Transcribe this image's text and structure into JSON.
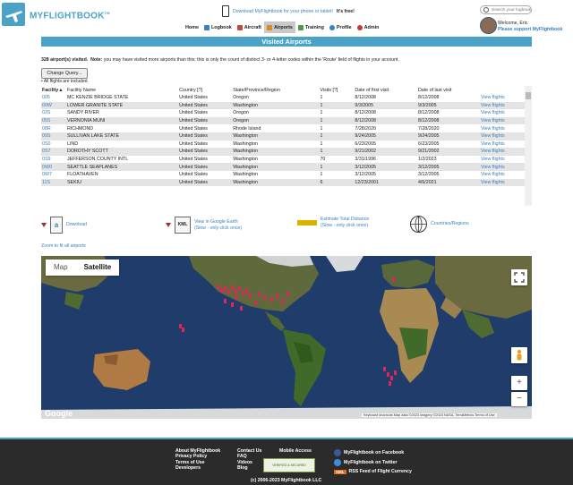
{
  "header": {
    "brand": "MYFLIGHTBOOK",
    "brand_tm": "TM",
    "promo_prefix": "Download MyFlightbook for your phone or tablet!",
    "promo_suffix": "It's free!",
    "search_placeholder": "Search your logbook",
    "welcome": "Welcome, Eric",
    "support": "Please support MyFlightbook"
  },
  "nav": {
    "items": [
      {
        "label": "Home",
        "color": "#ffffff"
      },
      {
        "label": "Logbook",
        "color": "#3a7fc0"
      },
      {
        "label": "Aircraft",
        "color": "#c04a3a"
      },
      {
        "label": "Airports",
        "color": "#d88a2a"
      },
      {
        "label": "Training",
        "color": "#4a9a4a"
      },
      {
        "label": "Profile",
        "color": "#3a7fc0"
      },
      {
        "label": "Admin",
        "color": "#c03a3a"
      }
    ],
    "active": "Airports"
  },
  "page": {
    "title": "Visited Airports",
    "summary_bold": "328 airport(s) visited.",
    "summary_note_label": "Note:",
    "summary_note": "you may have visited more airports than this; this is only the count of distinct 3- or 4-letter codes within the 'Route' field of flights in your account.",
    "change_query": "Change Query...",
    "all_flights": "• All flights are included",
    "zoom_fit": "Zoom to fit all airports"
  },
  "table": {
    "headers": [
      "Facility▲",
      "Facility Name",
      "Country [?]",
      "State/Province/Region",
      "Visits [?]",
      "Date of first visit",
      "Date of last visit",
      ""
    ],
    "rows": [
      [
        "005",
        "MC KENZIE BRIDGE STATE",
        "United States",
        "Oregon",
        "1",
        "8/12/2008",
        "8/12/2008",
        "View flights"
      ],
      [
        "00W",
        "LOWER GRANITE STATE",
        "United States",
        "Washington",
        "1",
        "9/3/2005",
        "9/3/2005",
        "View flights"
      ],
      [
        "03S",
        "SANDY RIVER",
        "United States",
        "Oregon",
        "1",
        "8/12/2008",
        "8/12/2008",
        "View flights"
      ],
      [
        "05S",
        "VERNONIA MUNI",
        "United States",
        "Oregon",
        "1",
        "8/12/2008",
        "8/12/2008",
        "View flights"
      ],
      [
        "08R",
        "RICHMOND",
        "United States",
        "Rhode Island",
        "1",
        "7/28/2020",
        "7/28/2020",
        "View flights"
      ],
      [
        "09S",
        "SULLIVAN LAKE STATE",
        "United States",
        "Washington",
        "1",
        "9/24/2005",
        "9/24/2005",
        "View flights"
      ],
      [
        "0S0",
        "LIND",
        "United States",
        "Washington",
        "1",
        "6/23/2005",
        "6/23/2005",
        "View flights"
      ],
      [
        "0S7",
        "DOROTHY SCOTT",
        "United States",
        "Washington",
        "1",
        "9/21/2002",
        "9/21/2002",
        "View flights"
      ],
      [
        "0S9",
        "JEFFERSON COUNTY INTL",
        "United States",
        "Washington",
        "70",
        "3/31/1996",
        "1/2/2023",
        "View flights"
      ],
      [
        "0W0",
        "SEATTLE SEAPLANES",
        "United States",
        "Washington",
        "1",
        "3/12/2005",
        "3/12/2005",
        "View flights"
      ],
      [
        "0W7",
        "FLOATHAVEN",
        "United States",
        "Washington",
        "1",
        "3/12/2005",
        "3/12/2005",
        "View flights"
      ],
      [
        "11S",
        "SEKIU",
        "United States",
        "Washington",
        "6",
        "12/23/2001",
        "4/6/2021",
        "View flights"
      ]
    ]
  },
  "exports": {
    "download": "Download",
    "kml_icon": "KML",
    "google_earth": "View in Google Earth",
    "google_earth_sub": "(Slow - only click once)",
    "estimate": "Estimate Total Distance",
    "estimate_sub": "(Slow - only click once)",
    "countries": "Countries/Regions"
  },
  "map": {
    "tab_map": "Map",
    "tab_satellite": "Satellite",
    "active_tab": "Satellite",
    "google": "Google",
    "attribution": "Keyboard shortcuts   Map data ©2023 Imagery ©2023 NASA, TerraMetrics   Terms of Use",
    "zoom_in": "+",
    "zoom_out": "−",
    "markers": [
      {
        "label": "US West",
        "lat": 47.5,
        "lon": -122.3
      },
      {
        "label": "US East",
        "lat": 41.7,
        "lon": -71.4
      }
    ]
  },
  "footer": {
    "col1": [
      "About MyFlightbook",
      "Privacy Policy",
      "Terms of Use",
      "Developers"
    ],
    "col2": [
      "Contact Us",
      "FAQ",
      "Videos",
      "Blog"
    ],
    "mobile": "Mobile Access",
    "badge": "VERIFIED & SECURED",
    "facebook": "MyFlightbook on Facebook",
    "twitter": "MyFlightbook on Twitter",
    "rss_icon": "XML",
    "rss": "RSS Feed of Flight Currency",
    "copyright": "(c) 2006-2023 MyFlightbook LLC"
  }
}
